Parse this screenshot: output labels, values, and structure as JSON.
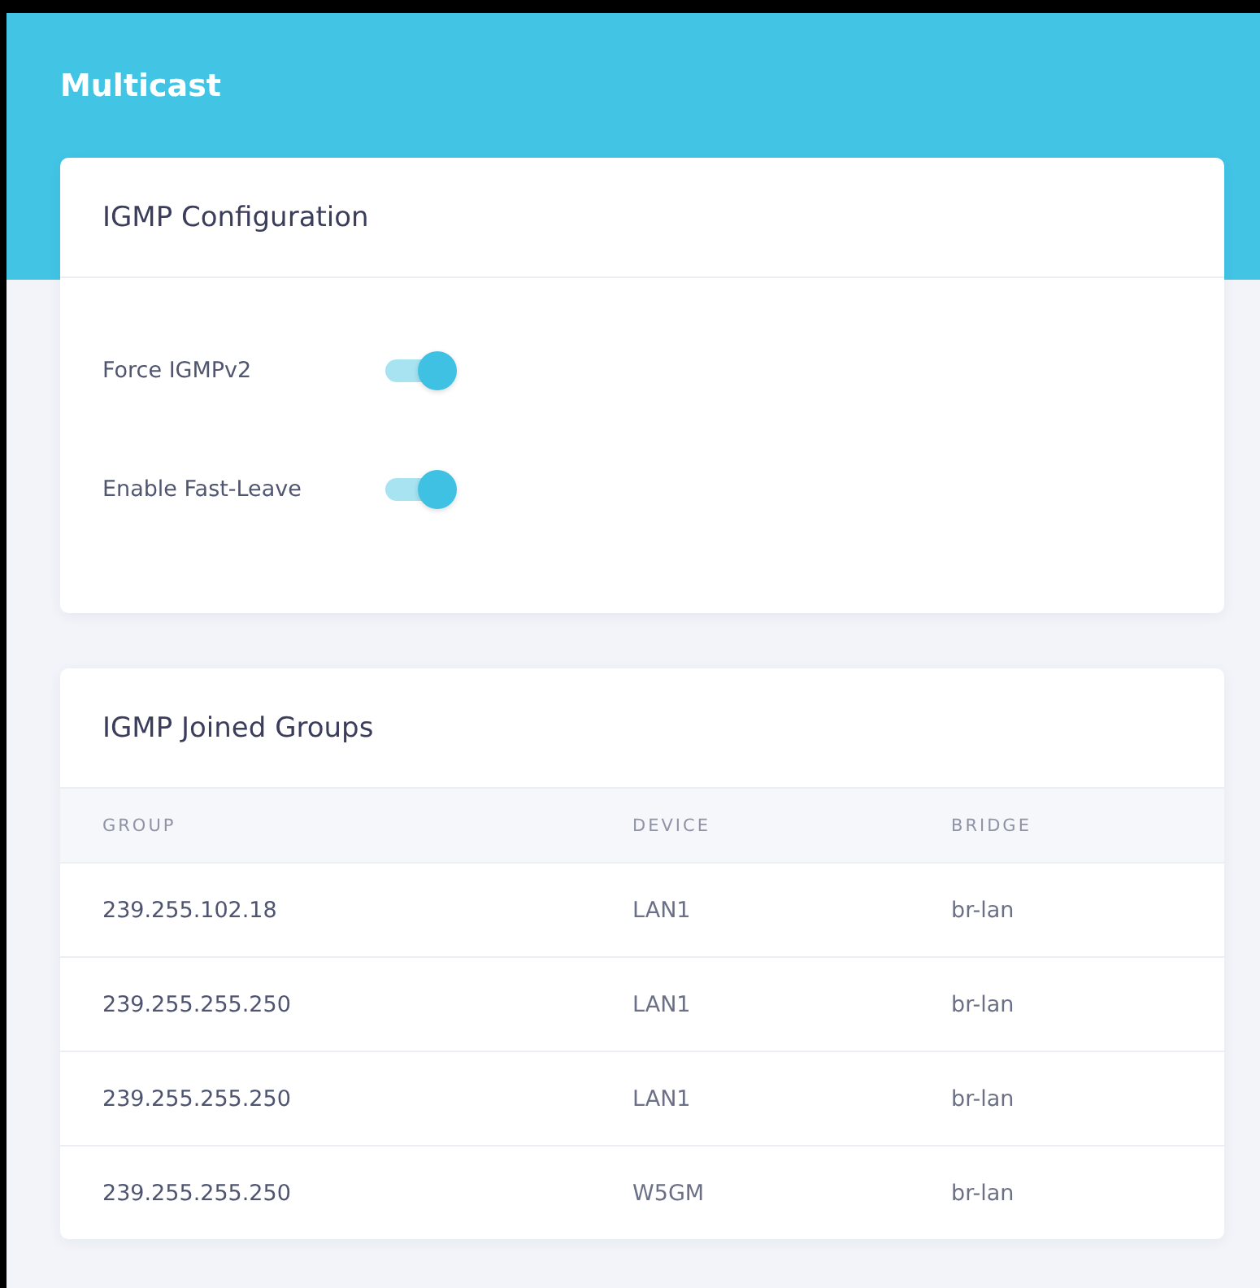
{
  "page": {
    "title": "Multicast"
  },
  "config": {
    "title": "IGMP Configuration",
    "settings": [
      {
        "label": "Force IGMPv2",
        "on": true
      },
      {
        "label": "Enable Fast-Leave",
        "on": true
      }
    ]
  },
  "groups": {
    "title": "IGMP Joined Groups",
    "columns": [
      "GROUP",
      "DEVICE",
      "BRIDGE"
    ],
    "rows": [
      [
        "239.255.102.18",
        "LAN1",
        "br-lan"
      ],
      [
        "239.255.255.250",
        "LAN1",
        "br-lan"
      ],
      [
        "239.255.255.250",
        "LAN1",
        "br-lan"
      ],
      [
        "239.255.255.250",
        "W5GM",
        "br-lan"
      ]
    ]
  }
}
